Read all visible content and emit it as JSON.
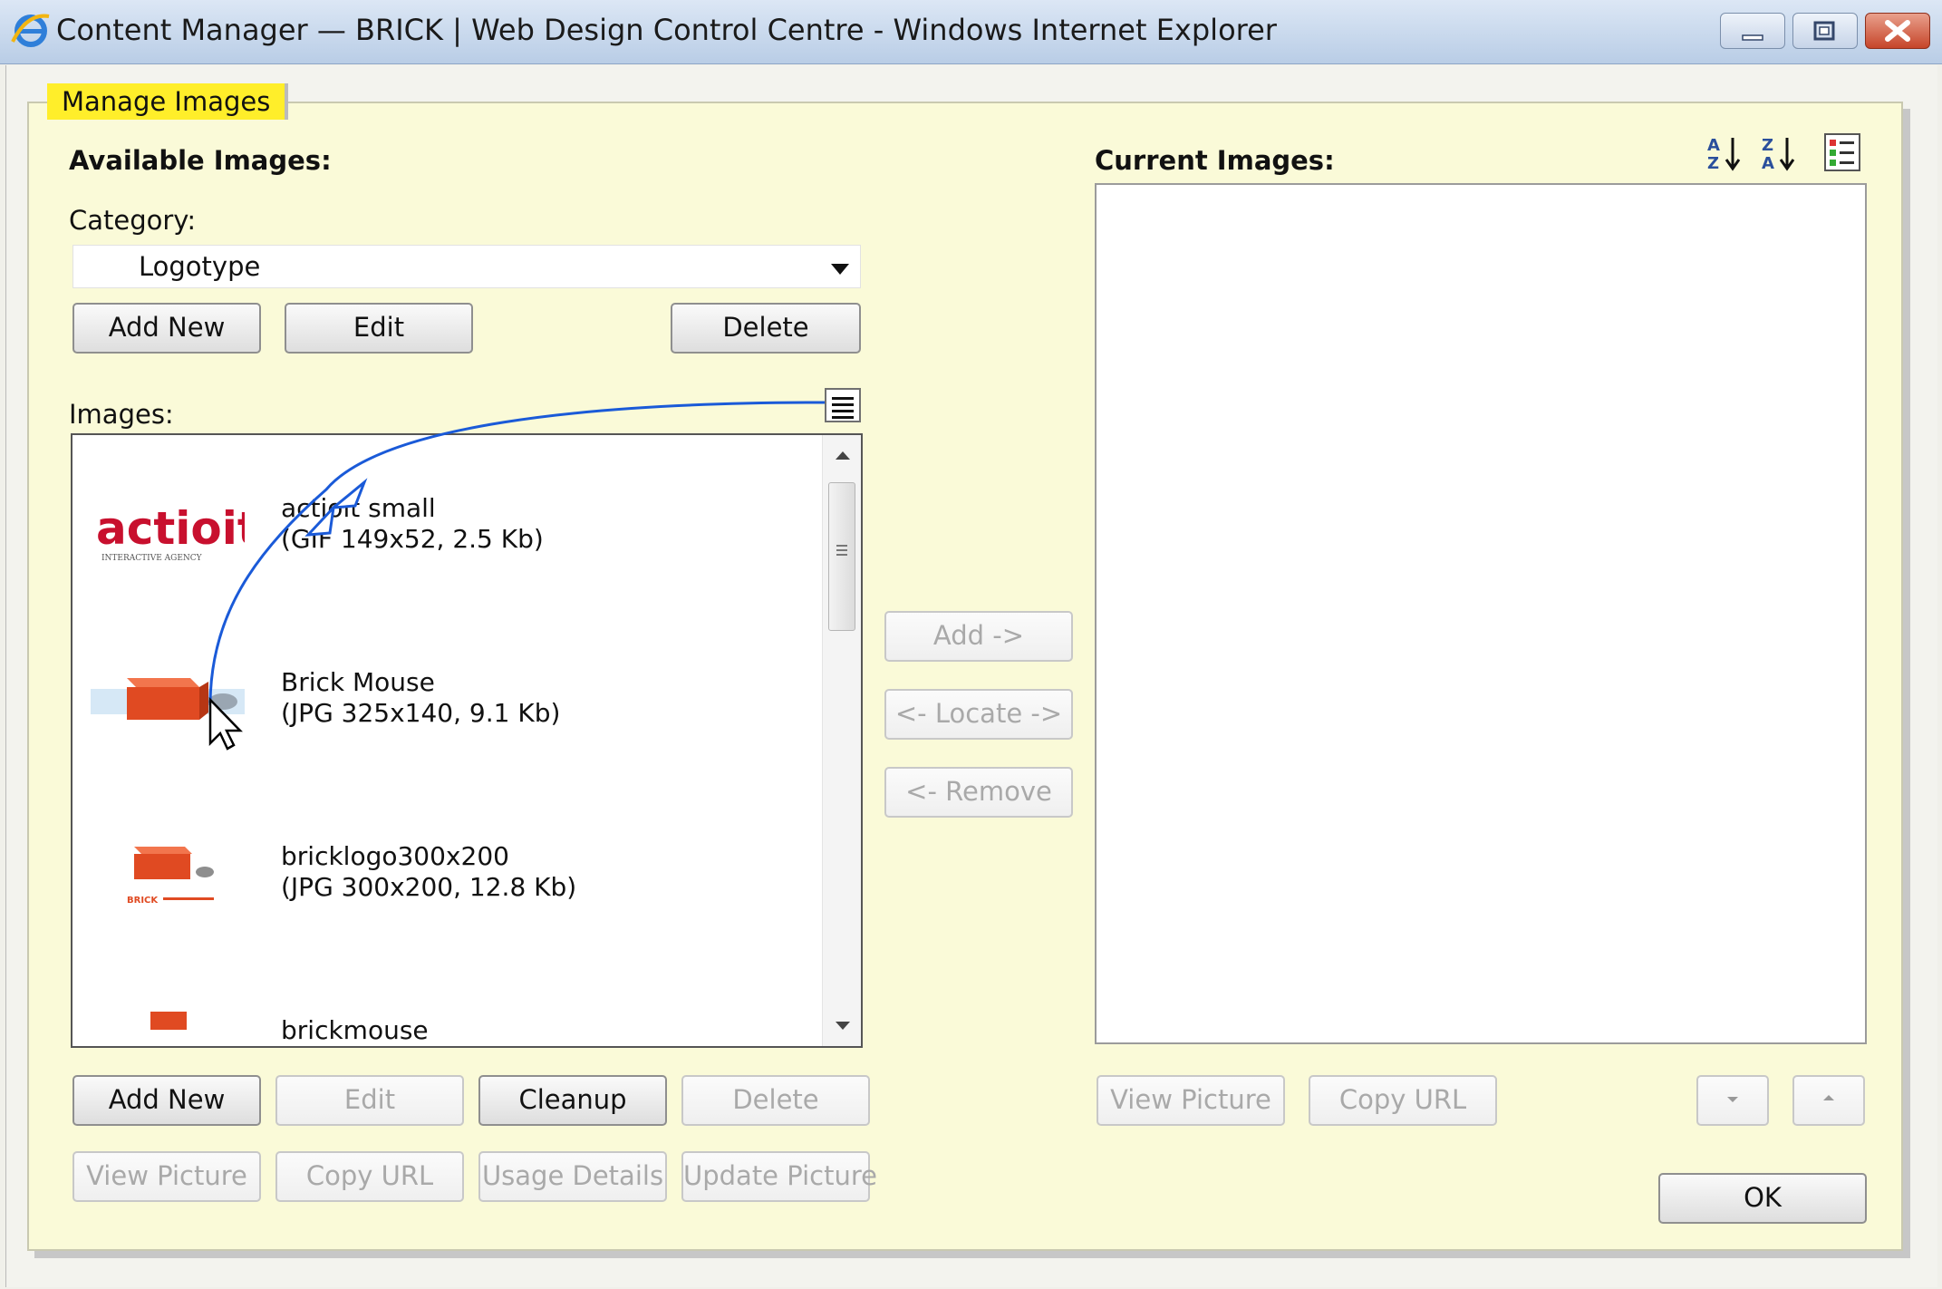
{
  "window": {
    "title": "Content Manager — BRICK | Web Design Control Centre - Windows Internet Explorer"
  },
  "tab": {
    "label": "Manage Images"
  },
  "available": {
    "heading": "Available Images:",
    "category_label": "Category:",
    "category_value": "Logotype",
    "category_buttons": {
      "add_new": "Add New",
      "edit": "Edit",
      "delete": "Delete"
    },
    "images_label": "Images:",
    "items": [
      {
        "name": "actioit small",
        "meta": "(GIF 149x52, 2.5 Kb)"
      },
      {
        "name": "Brick Mouse",
        "meta": "(JPG 325x140, 9.1 Kb)"
      },
      {
        "name": "bricklogo300x200",
        "meta": "(JPG 300x200, 12.8 Kb)"
      },
      {
        "name": "brickmouse",
        "meta": ""
      }
    ],
    "image_buttons": {
      "add_new": "Add New",
      "edit": "Edit",
      "cleanup": "Cleanup",
      "delete": "Delete",
      "view_picture": "View Picture",
      "copy_url": "Copy URL",
      "usage_details": "Usage Details",
      "update_picture": "Update Picture"
    }
  },
  "transfer": {
    "add": "Add ->",
    "locate": "<- Locate ->",
    "remove": "<- Remove"
  },
  "current": {
    "heading": "Current Images:",
    "buttons": {
      "view_picture": "View Picture",
      "copy_url": "Copy URL"
    },
    "ok": "OK"
  },
  "logos": {
    "actioit": "actioit",
    "actioit_sub": "INTERACTIVE AGENCY",
    "brick": "BRICK"
  },
  "colors": {
    "tab_yellow": "#ffee2a",
    "panel_bg": "#fafad8",
    "accent_blue": "#1a5ad8",
    "actioit_red": "#c8102e"
  }
}
